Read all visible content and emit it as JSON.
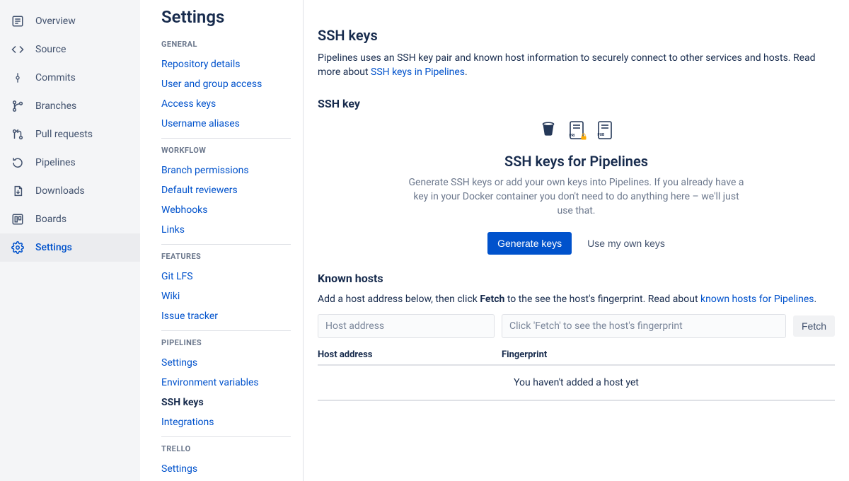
{
  "leftNav": {
    "items": [
      {
        "label": "Overview",
        "icon": "overview"
      },
      {
        "label": "Source",
        "icon": "source"
      },
      {
        "label": "Commits",
        "icon": "commits"
      },
      {
        "label": "Branches",
        "icon": "branches"
      },
      {
        "label": "Pull requests",
        "icon": "pullrequests"
      },
      {
        "label": "Pipelines",
        "icon": "pipelines"
      },
      {
        "label": "Downloads",
        "icon": "downloads"
      },
      {
        "label": "Boards",
        "icon": "boards"
      },
      {
        "label": "Settings",
        "icon": "settings"
      }
    ],
    "activeIndex": 8
  },
  "settings": {
    "title": "Settings",
    "sections": {
      "general": {
        "header": "GENERAL",
        "links": [
          "Repository details",
          "User and group access",
          "Access keys",
          "Username aliases"
        ]
      },
      "workflow": {
        "header": "WORKFLOW",
        "links": [
          "Branch permissions",
          "Default reviewers",
          "Webhooks",
          "Links"
        ]
      },
      "features": {
        "header": "FEATURES",
        "links": [
          "Git LFS",
          "Wiki",
          "Issue tracker"
        ]
      },
      "pipelines": {
        "header": "PIPELINES",
        "links": [
          "Settings",
          "Environment variables",
          "SSH keys",
          "Integrations"
        ],
        "currentIndex": 2
      },
      "trello": {
        "header": "TRELLO",
        "links": [
          "Settings"
        ]
      }
    }
  },
  "main": {
    "heading": "SSH keys",
    "desc1": "Pipelines uses an SSH key pair and known host information to securely connect to other services and hosts. Read more about ",
    "descLink": "SSH keys in Pipelines",
    "sshKeyHeader": "SSH key",
    "promo": {
      "title": "SSH keys for Pipelines",
      "text": "Generate SSH keys or add your own keys into Pipelines. If you already have a key in your Docker container you don't need to do anything here – we'll just use that.",
      "generateBtn": "Generate keys",
      "ownKeysBtn": "Use my own keys"
    },
    "knownHosts": {
      "header": "Known hosts",
      "desc1": "Add a host address below, then click ",
      "descBold": "Fetch",
      "desc2": " to the see the host's fingerprint. Read about ",
      "descLink": "known hosts for Pipelines",
      "hostPlaceholder": "Host address",
      "fingerprintPlaceholder": "Click 'Fetch' to see the host's fingerprint",
      "fetchBtn": "Fetch",
      "colHost": "Host address",
      "colFingerprint": "Fingerprint",
      "emptyMsg": "You haven't added a host yet"
    }
  }
}
